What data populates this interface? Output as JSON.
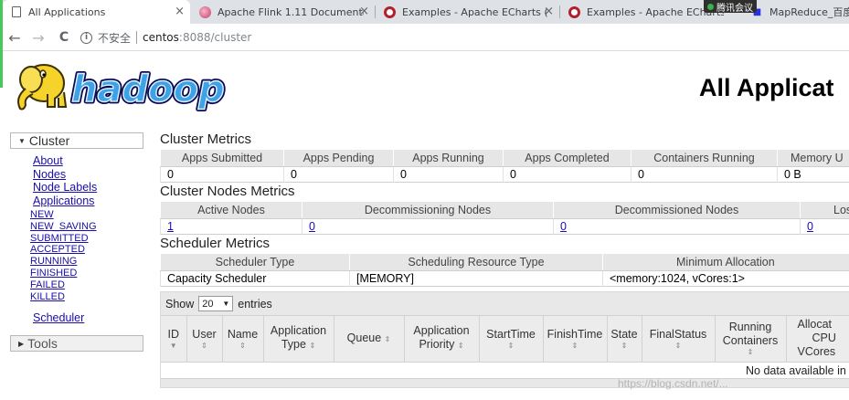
{
  "browser": {
    "tabs": [
      {
        "label": "All Applications",
        "icon": "page-icon"
      },
      {
        "label": "Apache Flink 1.11 Documentat",
        "icon": "flink-icon"
      },
      {
        "label": "Examples - Apache ECharts (in",
        "icon": "echarts-icon"
      },
      {
        "label": "Examples - Apache ECharts (",
        "icon": "echarts-icon"
      },
      {
        "label": "MapReduce_百度百",
        "icon": "baidu-icon"
      }
    ],
    "tab_close": "×",
    "overlay_label": "腾讯会议",
    "address": {
      "security_label": "不安全",
      "host": "centos",
      "path": ":8088/cluster"
    },
    "nav_back": "←",
    "nav_forward": "→",
    "nav_reload": "C"
  },
  "header": {
    "logo_text": "hadoop",
    "title": "All Applicat"
  },
  "sidebar": {
    "cluster_label": "Cluster",
    "links": [
      "About",
      "Nodes",
      "Node Labels",
      "Applications"
    ],
    "app_states": [
      "NEW",
      "NEW_SAVING",
      "SUBMITTED",
      "ACCEPTED",
      "RUNNING",
      "FINISHED",
      "FAILED",
      "KILLED"
    ],
    "scheduler_label": "Scheduler",
    "tools_label": "Tools"
  },
  "cluster_metrics": {
    "title": "Cluster Metrics",
    "headers": [
      "Apps Submitted",
      "Apps Pending",
      "Apps Running",
      "Apps Completed",
      "Containers Running",
      "Memory U"
    ],
    "values": [
      "0",
      "0",
      "0",
      "0",
      "0",
      "0 B"
    ]
  },
  "node_metrics": {
    "title": "Cluster Nodes Metrics",
    "headers": [
      "Active Nodes",
      "Decommissioning Nodes",
      "Decommissioned Nodes",
      "Los"
    ],
    "values": [
      "1",
      "0",
      "0",
      "0"
    ]
  },
  "scheduler_metrics": {
    "title": "Scheduler Metrics",
    "headers": [
      "Scheduler Type",
      "Scheduling Resource Type",
      "Minimum Allocation"
    ],
    "values": [
      "Capacity Scheduler",
      "[MEMORY]",
      "<memory:1024, vCores:1>"
    ]
  },
  "apps_table": {
    "show_label": "Show",
    "page_size": "20",
    "entries_label": "entries",
    "columns": [
      {
        "line1": "ID",
        "line2": ""
      },
      {
        "line1": "User",
        "line2": ""
      },
      {
        "line1": "Name",
        "line2": ""
      },
      {
        "line1": "Application",
        "line2": "Type"
      },
      {
        "line1": "Queue",
        "line2": ""
      },
      {
        "line1": "Application",
        "line2": "Priority"
      },
      {
        "line1": "StartTime",
        "line2": ""
      },
      {
        "line1": "FinishTime",
        "line2": ""
      },
      {
        "line1": "State",
        "line2": ""
      },
      {
        "line1": "FinalStatus",
        "line2": ""
      },
      {
        "line1": "Running",
        "line2": "Containers"
      },
      {
        "line1": "Allocat",
        "line2": "CPU"
      }
    ],
    "extra_header_line": "VCores",
    "empty_message": "No data available in"
  },
  "watermark": "https://blog.csdn.net/..."
}
